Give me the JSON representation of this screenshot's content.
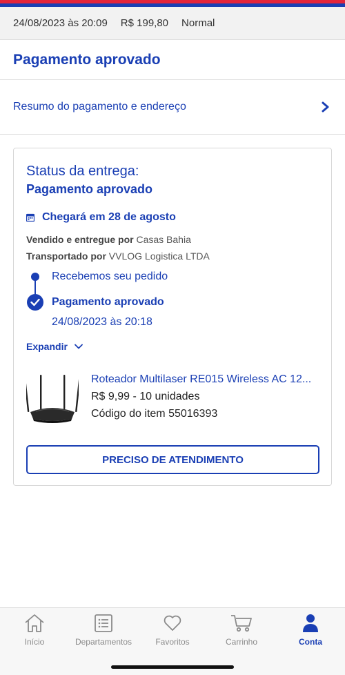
{
  "colors": {
    "brand_blue": "#1a3fb4",
    "brand_red": "#e3243b"
  },
  "order": {
    "date": "24/08/2023 às 20:09",
    "total": "R$ 199,80",
    "shipping": "Normal"
  },
  "payment_title": "Pagamento aprovado",
  "summary_link": "Resumo do pagamento e endereço",
  "delivery": {
    "status_label": "Status da entrega:",
    "status_value": "Pagamento aprovado",
    "arrival": "Chegará em 28 de agosto",
    "seller_label": "Vendido e entregue por",
    "seller": "Casas Bahia",
    "carrier_label": "Transportado por",
    "carrier": "VVLOG Logistica LTDA",
    "steps": [
      {
        "label": "Recebemos seu pedido"
      },
      {
        "label": "Pagamento aprovado",
        "date": "24/08/2023 às 20:18"
      }
    ],
    "expand_label": "Expandir"
  },
  "product": {
    "name": "Roteador Multilaser RE015 Wireless AC 12...",
    "price_qty": "R$ 9,99 - 10 unidades",
    "code": "Código do item 55016393"
  },
  "help_button": "PRECISO DE ATENDIMENTO",
  "nav": [
    {
      "label": "Início",
      "icon": "home-icon"
    },
    {
      "label": "Departamentos",
      "icon": "list-icon"
    },
    {
      "label": "Favoritos",
      "icon": "heart-icon"
    },
    {
      "label": "Carrinho",
      "icon": "cart-icon"
    },
    {
      "label": "Conta",
      "icon": "user-icon",
      "active": true
    }
  ]
}
